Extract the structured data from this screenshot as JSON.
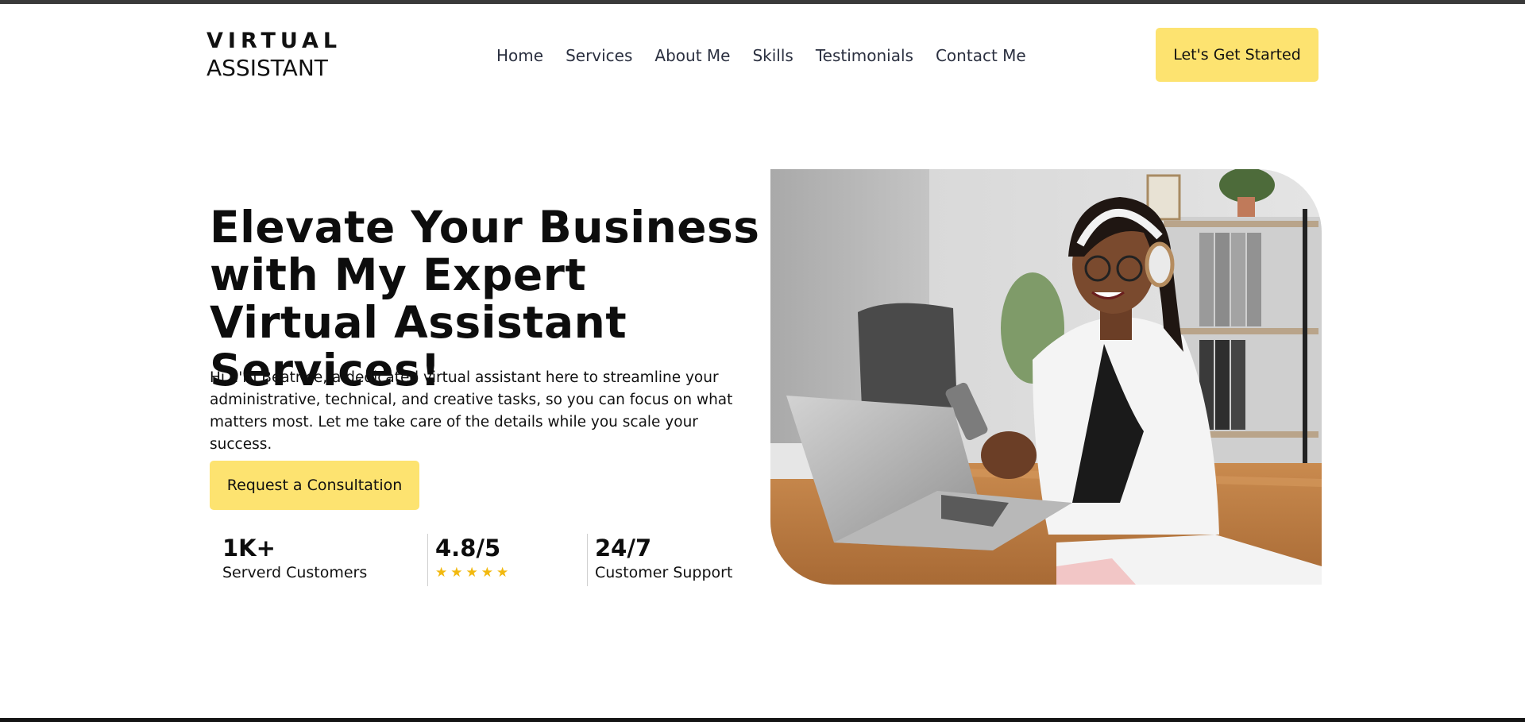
{
  "brand": {
    "line1": "VIRTUAL",
    "line2": "ASSISTANT"
  },
  "nav": {
    "items": [
      {
        "label": "Home"
      },
      {
        "label": "Services"
      },
      {
        "label": "About Me"
      },
      {
        "label": "Skills"
      },
      {
        "label": "Testimonials"
      },
      {
        "label": "Contact Me"
      }
    ]
  },
  "header_cta": {
    "label": "Let's Get Started"
  },
  "hero": {
    "title": "Elevate Your Business with My Expert Virtual Assistant Services!",
    "description": "Hi, I'm Beatrice, a dedicated virtual assistant here to streamline your administrative, technical, and creative tasks, so you can focus on what matters most. Let me take care of the details while you scale your success.",
    "cta_label": "Request a Consultation"
  },
  "stats": [
    {
      "value": "1K+",
      "label": "Serverd Customers"
    },
    {
      "value": "4.8/5",
      "rating": 5
    },
    {
      "value": "24/7",
      "label": "Customer Support"
    }
  ],
  "colors": {
    "accent": "#fde370",
    "star": "#f2b90f",
    "nav_text": "#2b3040",
    "heading": "#0d0d0d"
  }
}
